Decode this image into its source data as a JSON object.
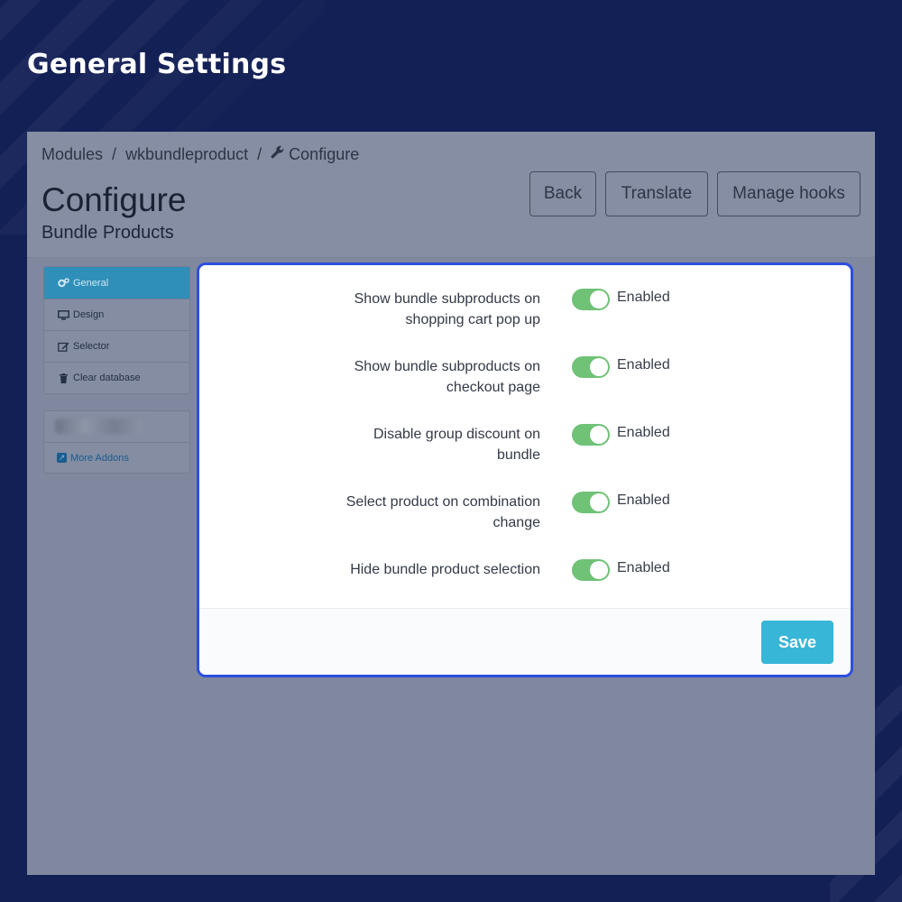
{
  "hero": {
    "title": "General Settings"
  },
  "breadcrumb": {
    "items": [
      "Modules",
      "wkbundleproduct",
      "Configure"
    ],
    "separator": "/"
  },
  "header": {
    "title": "Configure",
    "subtitle": "Bundle Products",
    "buttons": {
      "back": "Back",
      "translate": "Translate",
      "manage_hooks": "Manage hooks"
    }
  },
  "sidebar": {
    "items": [
      {
        "label": "General",
        "icon": "cogs-icon",
        "active": true
      },
      {
        "label": "Design",
        "icon": "desktop-icon",
        "active": false
      },
      {
        "label": "Selector",
        "icon": "edit-icon",
        "active": false
      },
      {
        "label": "Clear database",
        "icon": "trash-icon",
        "active": false
      }
    ],
    "addons_link": "More Addons"
  },
  "settings": [
    {
      "label": "Show bundle subproducts on shopping cart pop up",
      "status": "Enabled",
      "enabled": true
    },
    {
      "label": "Show bundle subproducts on checkout page",
      "status": "Enabled",
      "enabled": true
    },
    {
      "label": "Disable group discount on bundle",
      "status": "Enabled",
      "enabled": true
    },
    {
      "label": "Select product on combination change",
      "status": "Enabled",
      "enabled": true
    },
    {
      "label": "Hide bundle product selection",
      "status": "Enabled",
      "enabled": true
    }
  ],
  "footer": {
    "save_label": "Save"
  },
  "colors": {
    "background": "#132055",
    "modal_border": "#2c4fe0",
    "toggle_on": "#6fc276",
    "save_button": "#37b6d8",
    "sidebar_active": "#2f8fb8"
  }
}
